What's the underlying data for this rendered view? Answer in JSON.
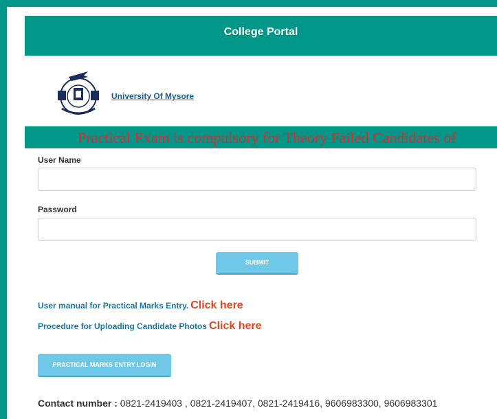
{
  "header": {
    "title": "College Portal"
  },
  "university": {
    "link_text": "University Of Mysore"
  },
  "notice": {
    "text": "Practical Exam is compulsory for Theory Failed Candidates of"
  },
  "login": {
    "username_label": "User Name",
    "username_value": "",
    "password_label": "Password",
    "password_value": "",
    "submit_label": "SUBMIT"
  },
  "links": {
    "manual_text": "User manual for Practical Marks Entry.",
    "manual_click": "Click here",
    "photos_text": "Procedure for Uploading Candidate Photos",
    "photos_click": "Click here"
  },
  "practical_button": {
    "label": "PRACTICAL MARKS ENTRY LOGIN"
  },
  "contact": {
    "label": "Contact number :",
    "numbers": "0821-2419403 , 0821-2419407, 0821-2419416, 9606983300, 9606983301"
  },
  "colors": {
    "teal": "#009688",
    "notice_red": "#d32f2f",
    "link_blue": "#1976a8",
    "click_orange": "#e0461e",
    "button_blue": "#70c8e8"
  }
}
